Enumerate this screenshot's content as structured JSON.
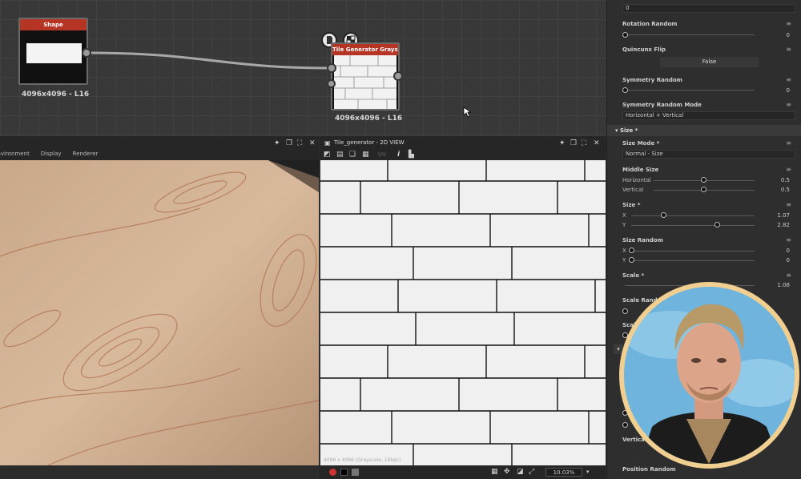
{
  "graph": {
    "nodes": [
      {
        "title": "Shape",
        "label": "4096x4096 - L16"
      },
      {
        "title": "Tile Generator Grayscale",
        "label": "4096x4096 - L16"
      }
    ],
    "floating_icons": [
      "document-icon",
      "checkerboard-icon"
    ]
  },
  "viewport3d": {
    "tabs": [
      "Environment",
      "Display",
      "Renderer"
    ]
  },
  "view2d": {
    "title": "Tile_generator - 2D VIEW",
    "info": "4096 x 4096 (Grayscale, 16bpc)",
    "zoom": "10.03%"
  },
  "panel": {
    "top_value": "0",
    "rotation_random": {
      "label": "Rotation Random",
      "value": "0"
    },
    "quincunx_flip": {
      "label": "Quincunx Flip",
      "value": "False"
    },
    "symmetry_random": {
      "label": "Symmetry Random",
      "value": "0"
    },
    "symmetry_random_mode": {
      "label": "Symmetry Random Mode",
      "value": "Horizontal + Vertical"
    },
    "size_section": "Size *",
    "size_mode": {
      "label": "Size Mode *",
      "value": "Normal - Size"
    },
    "middle_size": {
      "label": "Middle Size",
      "h_label": "Horizontal",
      "h_value": "0.5",
      "v_label": "Vertical",
      "v_value": "0.5"
    },
    "size": {
      "label": "Size *",
      "x_label": "X",
      "x_value": "1.07",
      "y_label": "Y",
      "y_value": "2.82"
    },
    "size_random": {
      "label": "Size Random",
      "x_label": "X",
      "x_value": "0",
      "y_label": "Y",
      "y_value": "0"
    },
    "scale": {
      "label": "Scale *",
      "value": "1.08"
    },
    "scale_random": {
      "label": "Scale Random"
    },
    "scale_partial": "Scal",
    "vertical_partial": "Vertical",
    "position_random": {
      "label": "Position Random"
    }
  },
  "colors": {
    "node_header": "#b53424",
    "avatar_ring": "#f0cf90",
    "avatar_bg": "#6fb4dd"
  }
}
